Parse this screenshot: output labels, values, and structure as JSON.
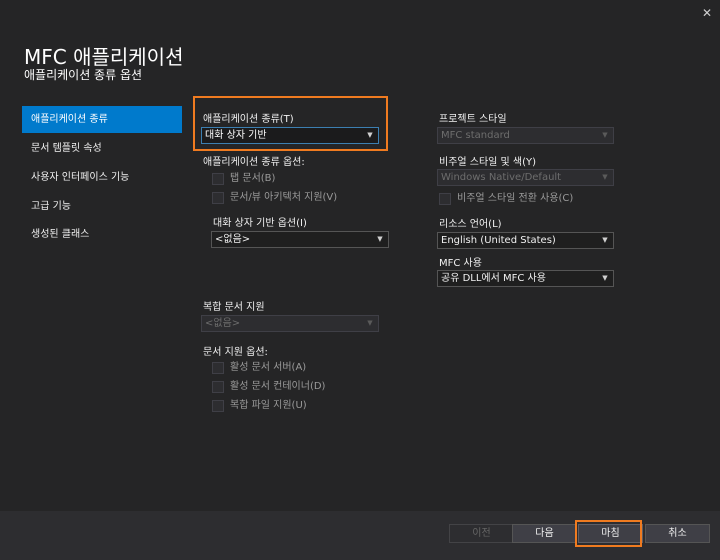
{
  "window": {
    "title": "MFC 애플리케이션",
    "subtitle": "애플리케이션 종류 옵션",
    "close_glyph": "✕"
  },
  "sidebar": {
    "items": [
      {
        "label": "애플리케이션 종류",
        "selected": true
      },
      {
        "label": "문서 템플릿 속성",
        "selected": false
      },
      {
        "label": "사용자 인터페이스 기능",
        "selected": false
      },
      {
        "label": "고급 기능",
        "selected": false
      },
      {
        "label": "생성된 클래스",
        "selected": false
      }
    ]
  },
  "app_type": {
    "label": "애플리케이션 종류(T)",
    "value": "대화 상자 기반",
    "options_label": "애플리케이션 종류 옵션:",
    "tabbed_docs_label": "탭 문서(B)",
    "doc_view_label": "문서/뷰 아키텍처 지원(V)",
    "dialog_options_label": "대화 상자 기반 옵션(I)",
    "dialog_options_value": "<없음>"
  },
  "compound": {
    "label": "복합 문서 지원",
    "value": "<없음>",
    "doc_support_label": "문서 지원 옵션:",
    "active_server_label": "활성 문서 서버(A)",
    "active_container_label": "활성 문서 컨테이너(D)",
    "compound_file_label": "복합 파일 지원(U)"
  },
  "project_style": {
    "label": "프로젝트 스타일",
    "value": "MFC standard",
    "visual_style_label": "비주얼 스타일 및 색(Y)",
    "visual_style_value": "Windows Native/Default",
    "visual_toggle_label": "비주얼 스타일 전환 사용(C)",
    "resource_lang_label": "리소스 언어(L)",
    "resource_lang_value": "English (United States)",
    "mfc_use_label": "MFC 사용",
    "mfc_use_value": "공유 DLL에서 MFC 사용"
  },
  "footer": {
    "prev_label": "이전",
    "next_label": "다음",
    "finish_label": "마침",
    "cancel_label": "취소"
  },
  "colors": {
    "background": "#252526",
    "accent": "#007acc",
    "highlight": "#f07b20"
  },
  "icons": {
    "close": "close-icon",
    "dropdown": "chevron-down-icon"
  }
}
